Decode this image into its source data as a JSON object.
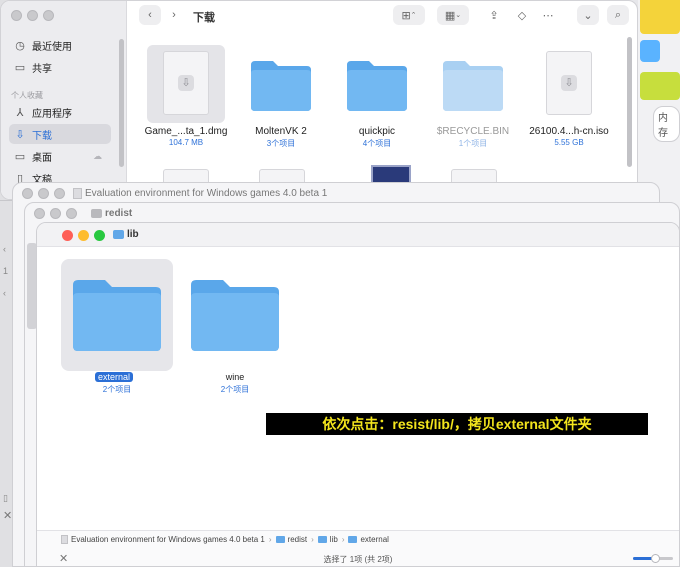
{
  "downloads_window": {
    "title": "下载",
    "sidebar": {
      "items": [
        {
          "label": "最近使用",
          "icon": "clock-icon"
        },
        {
          "label": "共享",
          "icon": "shared-folder-icon"
        },
        {
          "label": "应用程序",
          "icon": "applications-icon"
        },
        {
          "label": "下载",
          "icon": "download-icon",
          "active": true
        },
        {
          "label": "桌面",
          "icon": "desktop-icon"
        },
        {
          "label": "文稿",
          "icon": "document-icon"
        }
      ],
      "section_favorites": "个人收藏"
    },
    "files": [
      {
        "name": "Game_...ta_1.dmg",
        "sub": "104.7 MB",
        "kind": "doc"
      },
      {
        "name": "MoltenVK 2",
        "sub": "3个项目",
        "kind": "folder"
      },
      {
        "name": "quickpic",
        "sub": "4个项目",
        "kind": "folder"
      },
      {
        "name": "$RECYCLE.BIN",
        "sub": "1个项目",
        "kind": "folder-dim"
      },
      {
        "name": "26100.4...h-cn.iso",
        "sub": "5.55 GB",
        "kind": "doc"
      }
    ]
  },
  "right_window": {
    "badge": "内存"
  },
  "eval_window": {
    "title": "Evaluation environment for Windows games 4.0 beta 1"
  },
  "redist_window": {
    "title": "redist"
  },
  "lib_window": {
    "title": "lib",
    "folders": [
      {
        "name": "external",
        "sub": "2个项目",
        "selected": true
      },
      {
        "name": "wine",
        "sub": "2个项目",
        "selected": false
      }
    ],
    "annotation": "依次点击：resist/lib/，拷贝external文件夹",
    "path": {
      "items": [
        "Evaluation environment for Windows games 4.0 beta 1",
        "redist",
        "lib",
        "external"
      ],
      "separator": "›"
    },
    "status": "选择了 1项 (共 2项)",
    "zoom_level": 0.55
  },
  "colors": {
    "accent": "#2b6fd6",
    "folder_blue": "#61a7e8",
    "annotation_bg": "#000000",
    "annotation_text": "#f3e51d",
    "traffic_red": "#fe5f57",
    "traffic_yellow": "#febc2e",
    "traffic_green": "#28c840"
  }
}
